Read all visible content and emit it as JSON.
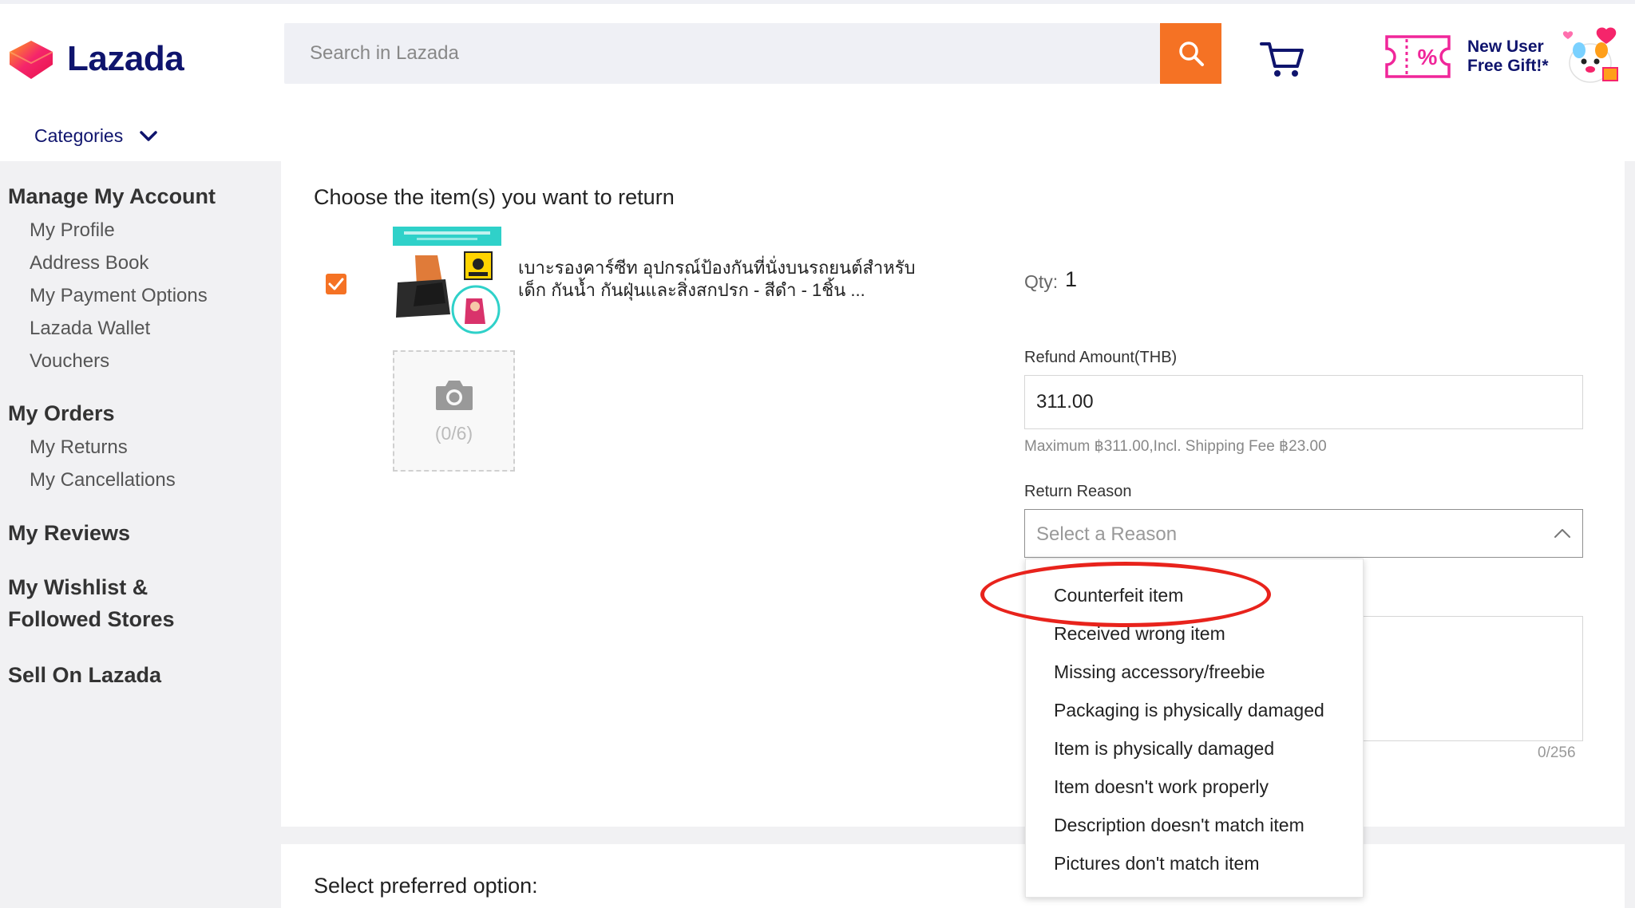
{
  "header": {
    "logo_text": "Lazada",
    "search_placeholder": "Search in Lazada",
    "promo_line1": "New User",
    "promo_line2": "Free Gift!*",
    "categories_label": "Categories"
  },
  "sidebar": {
    "manage_account": "Manage My Account",
    "account_items": [
      "My Profile",
      "Address Book",
      "My Payment Options",
      "Lazada Wallet",
      "Vouchers"
    ],
    "my_orders": "My Orders",
    "order_items": [
      "My Returns",
      "My Cancellations"
    ],
    "my_reviews": "My Reviews",
    "wishlist_line1": "My Wishlist &",
    "wishlist_line2": "Followed Stores",
    "sell": "Sell On Lazada"
  },
  "return_form": {
    "choose_title": "Choose the item(s) you want to return",
    "product_name": "เบาะรองคาร์ซีท        อุปกรณ์ป้องกันที่นั่งบนรถยนต์สำหรับเด็ก กันน้ำ กันฝุ่นและสิ่งสกปรก - สีดำ - 1ชิ้น ...",
    "product_checked": true,
    "upload_count": "(0/6)",
    "qty_label": "Qty:",
    "qty_value": "1",
    "refund_label": "Refund Amount(THB)",
    "refund_value": "311.00",
    "refund_note": "Maximum ฿311.00,Incl. Shipping Fee ฿23.00",
    "reason_label": "Return Reason",
    "reason_placeholder": "Select a Reason",
    "char_count": "0/256",
    "reason_options": [
      "Counterfeit item",
      "Received wrong item",
      "Missing accessory/freebie",
      "Packaging is physically damaged",
      "Item is physically damaged",
      "Item doesn't work properly",
      "Description doesn't match item",
      "Pictures don't match item"
    ],
    "highlighted_option": "Counterfeit item",
    "preferred_title": "Select preferred option:"
  },
  "colors": {
    "brand_navy": "#0f146d",
    "accent_orange": "#f57224",
    "highlight_red": "#e8231c"
  }
}
